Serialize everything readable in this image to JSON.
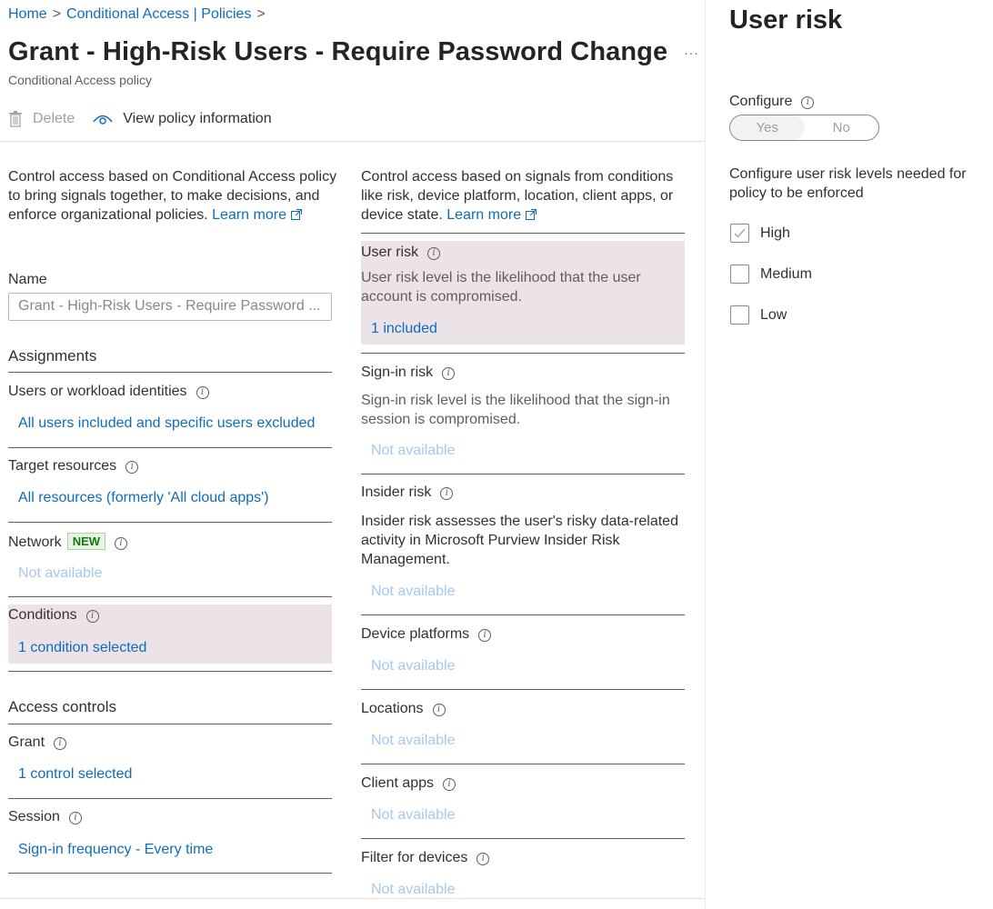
{
  "breadcrumb": {
    "home": "Home",
    "sep": ">",
    "policies": "Conditional Access | Policies"
  },
  "page": {
    "title": "Grant - High-Risk Users - Require Password Change",
    "more": "···",
    "subtitle": "Conditional Access policy"
  },
  "toolbar": {
    "delete": "Delete",
    "view_info": "View policy information"
  },
  "left": {
    "description": "Control access based on Conditional Access policy to bring signals together, to make decisions, and enforce organizational policies.",
    "learn_more": "Learn more",
    "name_label": "Name",
    "name_value": "Grant - High-Risk Users - Require Password ...",
    "assignments": "Assignments",
    "users_label": "Users or workload identities",
    "users_value": "All users included and specific users excluded",
    "target_label": "Target resources",
    "target_value": "All resources (formerly 'All cloud apps')",
    "network_label": "Network",
    "network_badge": "NEW",
    "network_value": "Not available",
    "conditions_label": "Conditions",
    "conditions_value": "1 condition selected",
    "access_controls": "Access controls",
    "grant_label": "Grant",
    "grant_value": "1 control selected",
    "session_label": "Session",
    "session_value": "Sign-in frequency - Every time"
  },
  "middle": {
    "description": "Control access based on signals from conditions like risk, device platform, location, client apps, or device state.",
    "learn_more": "Learn more",
    "user_risk_label": "User risk",
    "user_risk_desc": "User risk level is the likelihood that the user account is compromised.",
    "user_risk_value": "1 included",
    "signin_label": "Sign-in risk",
    "signin_desc": "Sign-in risk level is the likelihood that the sign-in session is compromised.",
    "signin_value": "Not available",
    "insider_label": "Insider risk",
    "insider_desc": "Insider risk assesses the user's risky data-related activity in Microsoft Purview Insider Risk Management.",
    "insider_value": "Not available",
    "platforms_label": "Device platforms",
    "platforms_value": "Not available",
    "locations_label": "Locations",
    "locations_value": "Not available",
    "client_label": "Client apps",
    "client_value": "Not available",
    "filter_label": "Filter for devices",
    "filter_value": "Not available"
  },
  "panel": {
    "title": "User risk",
    "configure_label": "Configure",
    "toggle_yes": "Yes",
    "toggle_no": "No",
    "levels_label": "Configure user risk levels needed for policy to be enforced",
    "levels": [
      {
        "label": "High",
        "checked": true
      },
      {
        "label": "Medium",
        "checked": false
      },
      {
        "label": "Low",
        "checked": false
      }
    ]
  },
  "colors": {
    "accent": "#0f6cbd",
    "highlight": "#ebe3e7",
    "disabled_link": "#a6c8ec",
    "badge_green": "#107c10"
  }
}
